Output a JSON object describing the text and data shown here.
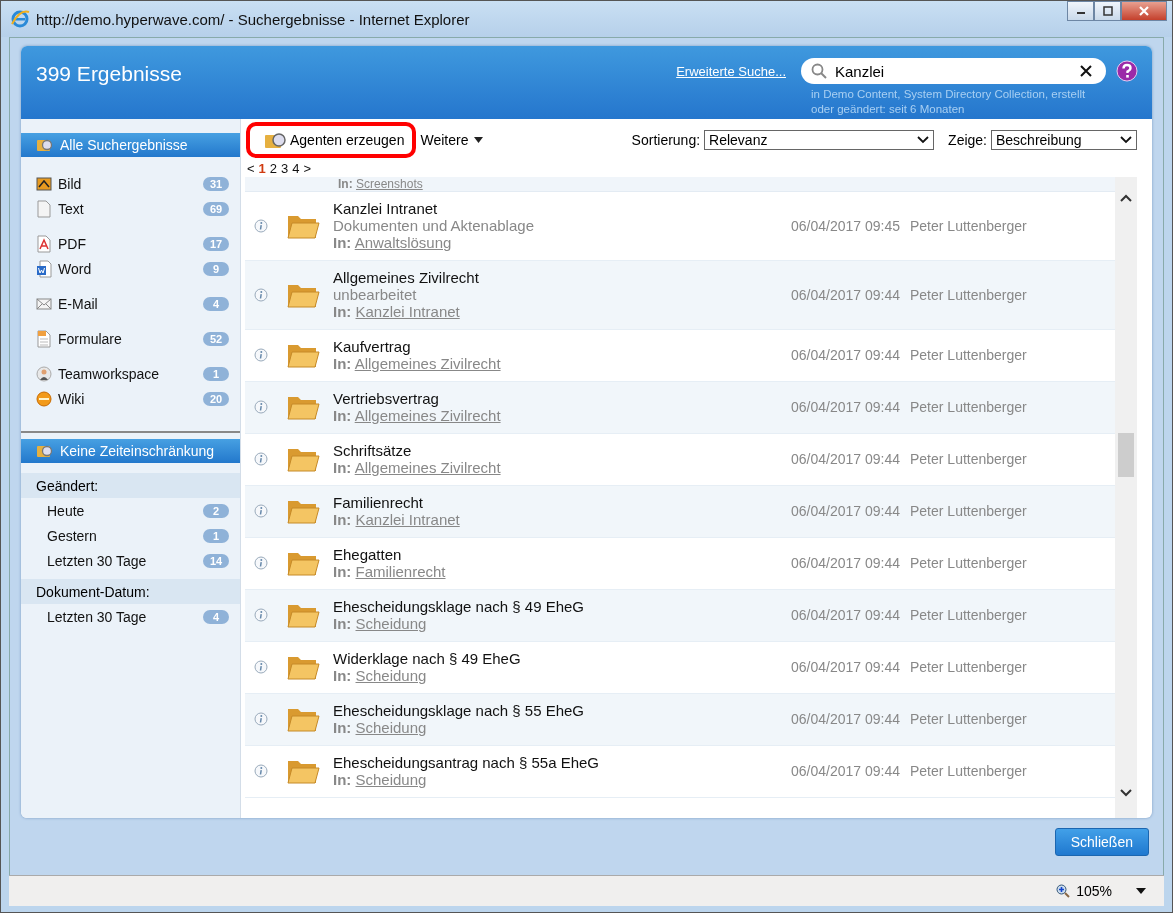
{
  "window": {
    "title": "http://demo.hyperwave.com/ - Suchergebnisse - Internet Explorer"
  },
  "header": {
    "result_count": "399 Ergebnisse",
    "advanced_link": "Erweiterte Suche...",
    "search": {
      "value": "Kanzlei",
      "scope": "in Demo Content, System Directory Collection, erstellt oder geändert: seit 6 Monaten"
    }
  },
  "sidebar": {
    "all_results": {
      "label": "Alle Suchergebnisse",
      "selected": true
    },
    "type_groups": [
      {
        "items": [
          {
            "kind": "image",
            "label": "Bild",
            "count": "31"
          },
          {
            "kind": "text",
            "label": "Text",
            "count": "69"
          }
        ]
      },
      {
        "items": [
          {
            "kind": "pdf",
            "label": "PDF",
            "count": "17"
          },
          {
            "kind": "word",
            "label": "Word",
            "count": "9"
          }
        ]
      },
      {
        "items": [
          {
            "kind": "mail",
            "label": "E-Mail",
            "count": "4"
          }
        ]
      },
      {
        "items": [
          {
            "kind": "form",
            "label": "Formulare",
            "count": "52"
          }
        ]
      },
      {
        "items": [
          {
            "kind": "team",
            "label": "Teamworkspace",
            "count": "1"
          },
          {
            "kind": "wiki",
            "label": "Wiki",
            "count": "20"
          }
        ]
      }
    ],
    "time_filter": {
      "label": "Keine Zeiteinschränkung",
      "selected": true
    },
    "time_sections": [
      {
        "heading": "Geändert:",
        "items": [
          {
            "label": "Heute",
            "count": "2"
          },
          {
            "label": "Gestern",
            "count": "1"
          },
          {
            "label": "Letzten 30 Tage",
            "count": "14"
          }
        ]
      },
      {
        "heading": "Dokument-Datum:",
        "items": [
          {
            "label": "Letzten 30 Tage",
            "count": "4"
          }
        ]
      }
    ]
  },
  "toolbar": {
    "agent_button": {
      "label": "Agenten erzeugen",
      "highlighted": true
    },
    "more_menu": "Weitere",
    "sort": {
      "label": "Sortierung:",
      "value": "Relevanz"
    },
    "show": {
      "label": "Zeige:",
      "value": "Beschreibung"
    }
  },
  "pagination": [
    {
      "label": "<",
      "selected": false
    },
    {
      "label": "1",
      "selected": true
    },
    {
      "label": "2",
      "selected": false
    },
    {
      "label": "3",
      "selected": false
    },
    {
      "label": "4",
      "selected": false
    },
    {
      "label": ">",
      "selected": false
    }
  ],
  "partial_row": {
    "in_label": "In:",
    "location": "Screenshots"
  },
  "results": [
    {
      "title": "Kanzlei Intranet",
      "description": "Dokumenten und Aktenablage",
      "in_label": "In:",
      "location": "Anwaltslösung",
      "date": "06/04/2017 09:45",
      "author": "Peter Luttenberger"
    },
    {
      "title": "Allgemeines Zivilrecht",
      "description": "unbearbeitet",
      "in_label": "In:",
      "location": "Kanzlei Intranet",
      "date": "06/04/2017 09:44",
      "author": "Peter Luttenberger"
    },
    {
      "title": "Kaufvertrag",
      "in_label": "In:",
      "location": "Allgemeines Zivilrecht",
      "date": "06/04/2017 09:44",
      "author": "Peter Luttenberger"
    },
    {
      "title": "Vertriebsvertrag",
      "in_label": "In:",
      "location": "Allgemeines Zivilrecht",
      "date": "06/04/2017 09:44",
      "author": "Peter Luttenberger"
    },
    {
      "title": "Schriftsätze",
      "in_label": "In:",
      "location": "Allgemeines Zivilrecht",
      "date": "06/04/2017 09:44",
      "author": "Peter Luttenberger"
    },
    {
      "title": "Familienrecht",
      "in_label": "In:",
      "location": "Kanzlei Intranet",
      "date": "06/04/2017 09:44",
      "author": "Peter Luttenberger"
    },
    {
      "title": "Ehegatten",
      "in_label": "In:",
      "location": "Familienrecht",
      "date": "06/04/2017 09:44",
      "author": "Peter Luttenberger"
    },
    {
      "title": "Ehescheidungsklage nach § 49 EheG",
      "in_label": "In:",
      "location": "Scheidung",
      "date": "06/04/2017 09:44",
      "author": "Peter Luttenberger"
    },
    {
      "title": "Widerklage nach § 49 EheG",
      "in_label": "In:",
      "location": "Scheidung",
      "date": "06/04/2017 09:44",
      "author": "Peter Luttenberger"
    },
    {
      "title": "Ehescheidungsklage nach § 55 EheG",
      "in_label": "In:",
      "location": "Scheidung",
      "date": "06/04/2017 09:44",
      "author": "Peter Luttenberger"
    },
    {
      "title": "Ehescheidungsantrag nach § 55a EheG",
      "in_label": "In:",
      "location": "Scheidung",
      "date": "06/04/2017 09:44",
      "author": "Peter Luttenberger"
    }
  ],
  "footer": {
    "close_button": "Schließen"
  },
  "status_bar": {
    "zoom": "105%"
  }
}
